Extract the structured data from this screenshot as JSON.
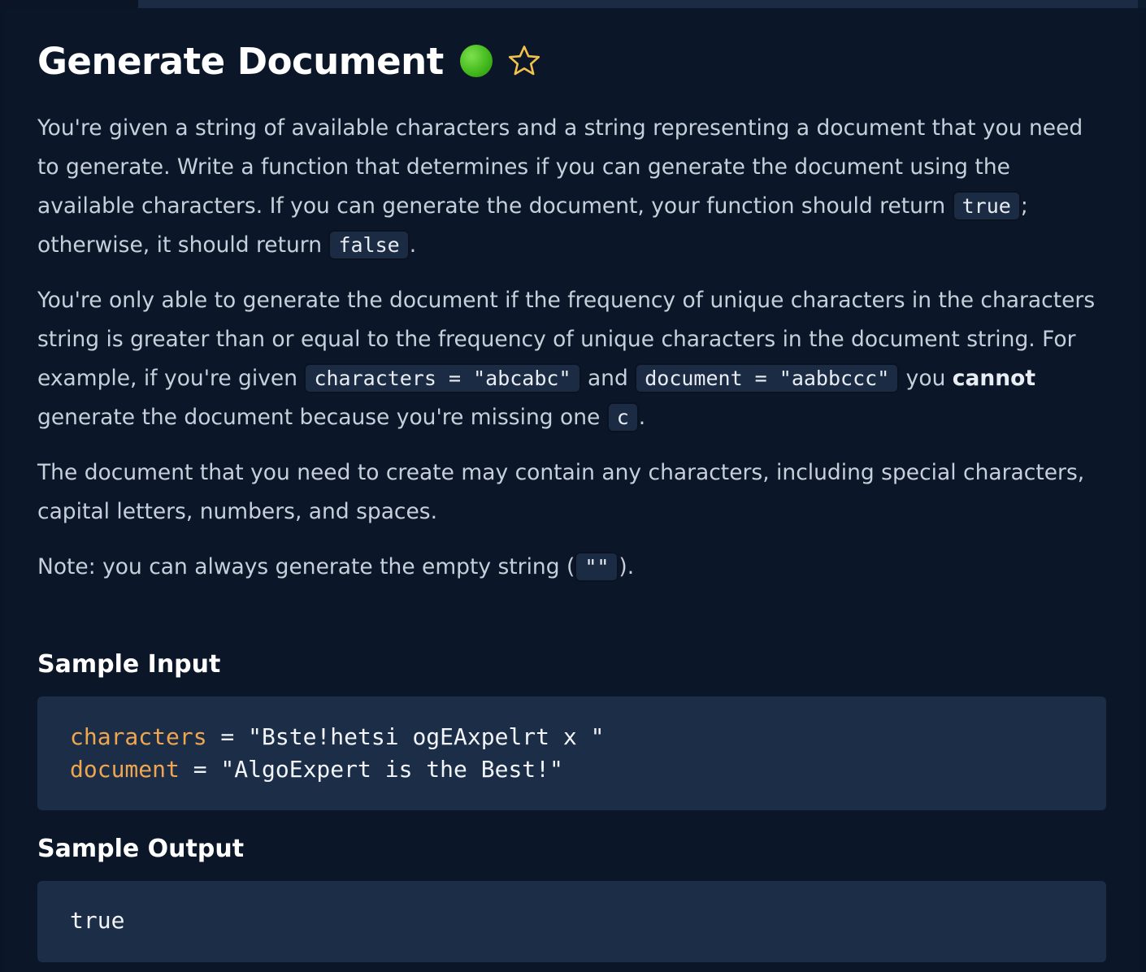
{
  "problem": {
    "title": "Generate Document",
    "status_color": "#4cc22a",
    "star_icon": "star-outline-icon",
    "star_color": "#f2c14e"
  },
  "description": {
    "p1": {
      "t1": "You're given a string of available characters and a string representing a document that you need to generate. Write a function that determines if you can generate the document using the available characters. If you can generate the document, your function should return ",
      "c1": "true",
      "t2": "; otherwise, it should return ",
      "c2": "false",
      "t3": "."
    },
    "p2": {
      "t1": "You're only able to generate the document if the frequency of unique characters in the characters string is greater than or equal to the frequency of unique characters in the document string. For example, if you're given ",
      "c1": "characters = \"abcabc\"",
      "t2": " and ",
      "c2": "document = \"aabbccc\"",
      "t3": " you ",
      "b1": "cannot",
      "t4": " generate the document because you're missing one ",
      "c3": "c",
      "t5": "."
    },
    "p3": {
      "t1": "The document that you need to create may contain any characters, including special characters, capital letters, numbers, and spaces."
    },
    "p4": {
      "t1": "Note: you can always generate the empty string (",
      "c1": "\"\"",
      "t2": ")."
    }
  },
  "sample_input": {
    "heading": "Sample Input",
    "lines": [
      {
        "name": "characters",
        "rest": " = \"Bste!hetsi ogEAxpelrt x \""
      },
      {
        "name": "document",
        "rest": " = \"AlgoExpert is the Best!\""
      }
    ],
    "name_color": "#f0a64f"
  },
  "sample_output": {
    "heading": "Sample Output",
    "value": "true"
  }
}
